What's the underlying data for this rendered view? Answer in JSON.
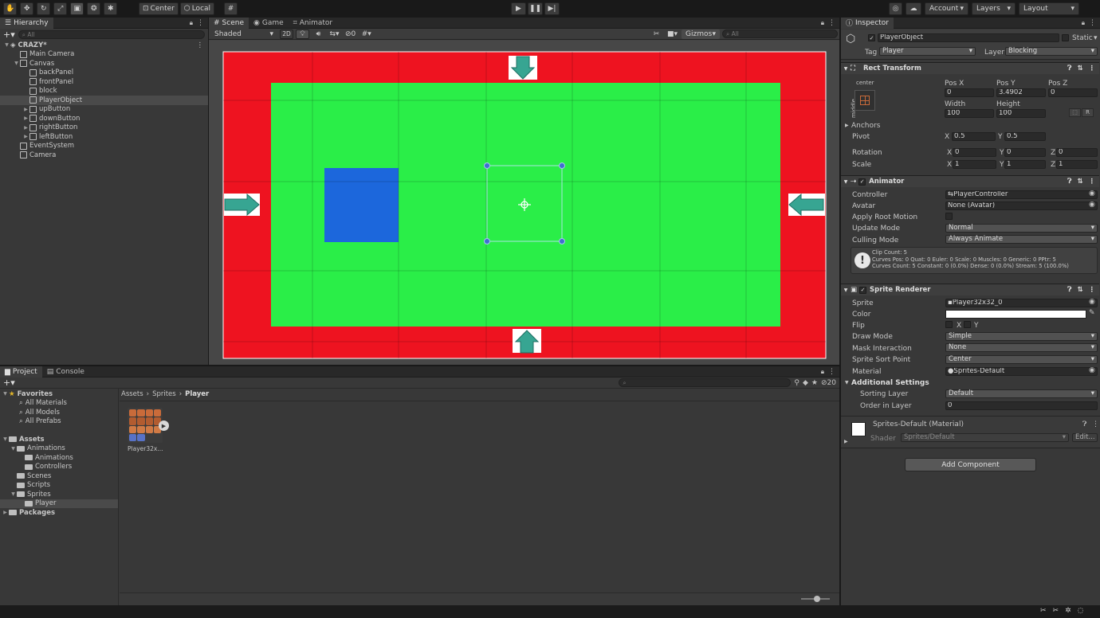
{
  "toolbar": {
    "pivot_label": "Center",
    "space_label": "Local",
    "account_label": "Account",
    "layers_label": "Layers",
    "layout_label": "Layout"
  },
  "hierarchy": {
    "tab": "Hierarchy",
    "search_placeholder": "All",
    "scene_name": "CRAZY*",
    "items": [
      {
        "label": "Main Camera",
        "depth": 1,
        "arrow": ""
      },
      {
        "label": "Canvas",
        "depth": 1,
        "arrow": "▼"
      },
      {
        "label": "backPanel",
        "depth": 2,
        "arrow": ""
      },
      {
        "label": "frontPanel",
        "depth": 2,
        "arrow": ""
      },
      {
        "label": "block",
        "depth": 2,
        "arrow": ""
      },
      {
        "label": "PlayerObject",
        "depth": 2,
        "arrow": "",
        "selected": true
      },
      {
        "label": "upButton",
        "depth": 2,
        "arrow": "▶"
      },
      {
        "label": "downButton",
        "depth": 2,
        "arrow": "▶"
      },
      {
        "label": "rightButton",
        "depth": 2,
        "arrow": "▶"
      },
      {
        "label": "leftButton",
        "depth": 2,
        "arrow": "▶"
      },
      {
        "label": "EventSystem",
        "depth": 1,
        "arrow": ""
      },
      {
        "label": "Camera",
        "depth": 1,
        "arrow": ""
      }
    ]
  },
  "scene": {
    "tabs": [
      "Scene",
      "Game",
      "Animator"
    ],
    "shading": "Shaded",
    "mode_2d": "2D",
    "hidden_count": "0",
    "gizmos": "Gizmos",
    "search_placeholder": "All"
  },
  "project": {
    "tabs": [
      "Project",
      "Console"
    ],
    "favorites_label": "Favorites",
    "favorites": [
      "All Materials",
      "All Models",
      "All Prefabs"
    ],
    "assets_label": "Assets",
    "tree": [
      {
        "label": "Animations",
        "depth": 1,
        "arrow": "▼"
      },
      {
        "label": "Animations",
        "depth": 2,
        "arrow": ""
      },
      {
        "label": "Controllers",
        "depth": 2,
        "arrow": ""
      },
      {
        "label": "Scenes",
        "depth": 1,
        "arrow": ""
      },
      {
        "label": "Scripts",
        "depth": 1,
        "arrow": ""
      },
      {
        "label": "Sprites",
        "depth": 1,
        "arrow": "▼"
      },
      {
        "label": "Player",
        "depth": 2,
        "arrow": "",
        "selected": true
      }
    ],
    "packages_label": "Packages",
    "breadcrumb": [
      "Assets",
      "Sprites",
      "Player"
    ],
    "asset_name": "Player32x...",
    "hidden_count": "20"
  },
  "inspector": {
    "tab": "Inspector",
    "object_name": "PlayerObject",
    "static_label": "Static",
    "tag_label": "Tag",
    "tag_value": "Player",
    "layer_label": "Layer",
    "layer_value": "Blocking",
    "rect_transform": {
      "title": "Rect Transform",
      "anchor_h": "center",
      "anchor_v": "middle",
      "pos_x_label": "Pos X",
      "pos_x": "0",
      "pos_y_label": "Pos Y",
      "pos_y": "3.4902",
      "pos_z_label": "Pos Z",
      "pos_z": "0",
      "width_label": "Width",
      "width": "100",
      "height_label": "Height",
      "height": "100",
      "r_label": "R",
      "anchors_label": "Anchors",
      "pivot_label": "Pivot",
      "pivot_x": "0.5",
      "pivot_y": "0.5",
      "rotation_label": "Rotation",
      "rot_x": "0",
      "rot_y": "0",
      "rot_z": "0",
      "scale_label": "Scale",
      "scale_x": "1",
      "scale_y": "1",
      "scale_z": "1"
    },
    "animator": {
      "title": "Animator",
      "controller_label": "Controller",
      "controller": "PlayerController",
      "avatar_label": "Avatar",
      "avatar": "None (Avatar)",
      "root_motion_label": "Apply Root Motion",
      "update_mode_label": "Update Mode",
      "update_mode": "Normal",
      "culling_mode_label": "Culling Mode",
      "culling_mode": "Always Animate",
      "info_line1": "Clip Count: 5",
      "info_line2": "Curves Pos: 0 Quat: 0 Euler: 0 Scale: 0 Muscles: 0 Generic: 0 PPtr: 5",
      "info_line3": "Curves Count: 5 Constant: 0 (0.0%) Dense: 0 (0.0%) Stream: 5 (100.0%)"
    },
    "sprite_renderer": {
      "title": "Sprite Renderer",
      "sprite_label": "Sprite",
      "sprite": "Player32x32_0",
      "color_label": "Color",
      "flip_label": "Flip",
      "flip_x": "X",
      "flip_y": "Y",
      "draw_mode_label": "Draw Mode",
      "draw_mode": "Simple",
      "mask_label": "Mask Interaction",
      "mask": "None",
      "sort_point_label": "Sprite Sort Point",
      "sort_point": "Center",
      "material_label": "Material",
      "material": "Sprites-Default",
      "additional_label": "Additional Settings",
      "sorting_layer_label": "Sorting Layer",
      "sorting_layer": "Default",
      "order_label": "Order in Layer",
      "order": "0"
    },
    "material": {
      "name": "Sprites-Default (Material)",
      "shader_label": "Shader",
      "shader": "Sprites/Default",
      "edit_label": "Edit..."
    },
    "add_component": "Add Component"
  },
  "colors": {
    "red_panel": "#ee1320",
    "green_panel": "#2aee48",
    "blue_block": "#1c67dc",
    "arrow_teal": "#37a592"
  }
}
